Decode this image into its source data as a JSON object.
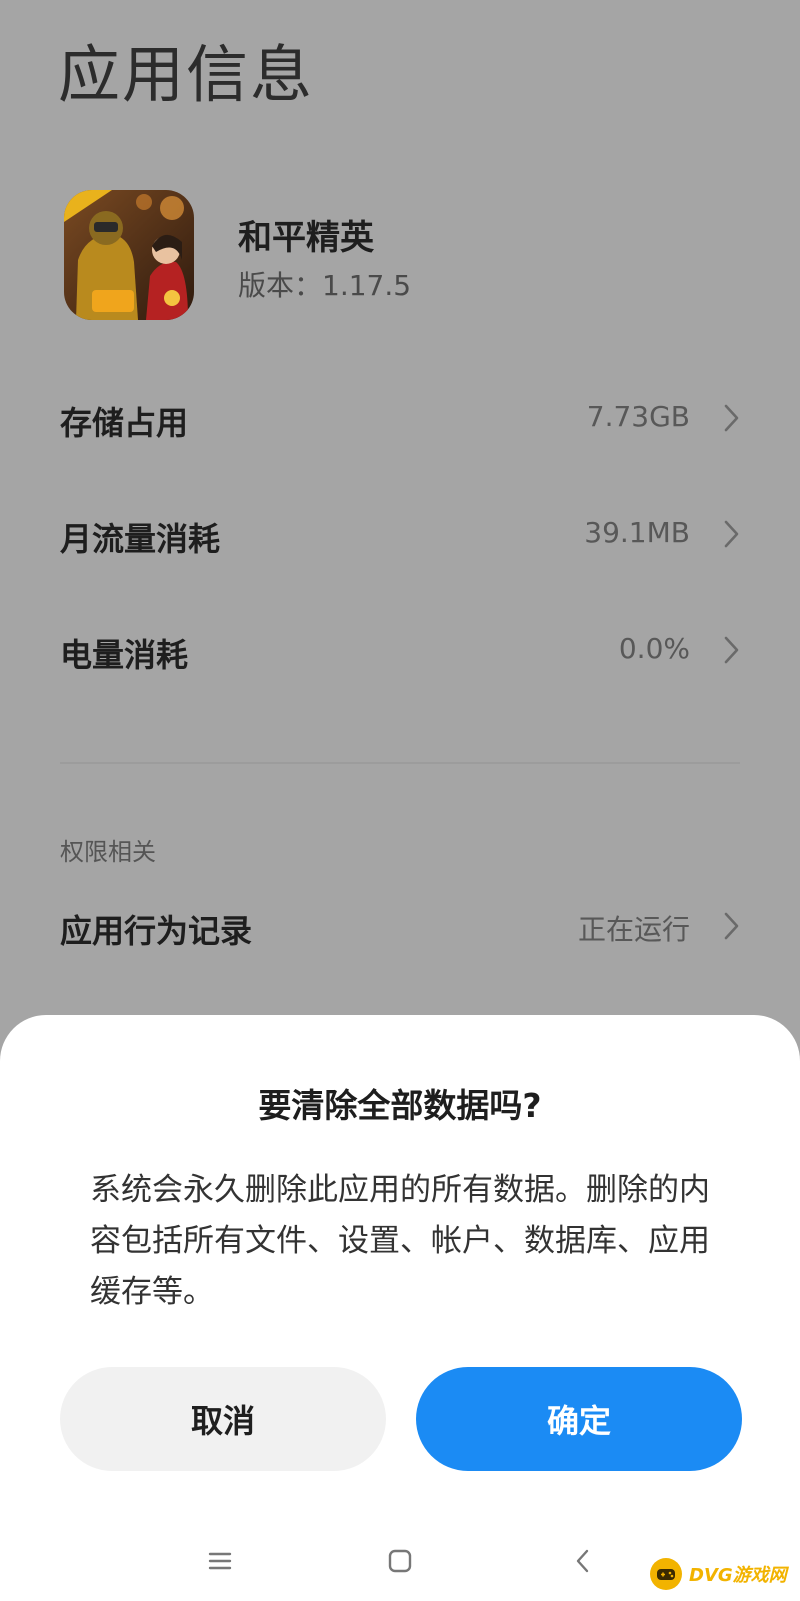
{
  "page": {
    "title": "应用信息"
  },
  "app": {
    "name": "和平精英",
    "version": "版本：1.17.5"
  },
  "rows": [
    {
      "label": "存储占用",
      "value": "7.73GB"
    },
    {
      "label": "月流量消耗",
      "value": "39.1MB"
    },
    {
      "label": "电量消耗",
      "value": "0.0%"
    }
  ],
  "permissions": {
    "section_label": "权限相关",
    "row": {
      "label": "应用行为记录",
      "value": "正在运行"
    }
  },
  "dialog": {
    "title": "要清除全部数据吗?",
    "message": "系统会永久删除此应用的所有数据。删除的内容包括所有文件、设置、帐户、数据库、应用缓存等。",
    "cancel_label": "取消",
    "confirm_label": "确定"
  },
  "navbar": {
    "icons": [
      "menu-icon",
      "home-icon",
      "back-icon"
    ]
  },
  "watermark": {
    "text": "DVG游戏网"
  },
  "colors": {
    "background": "#a5a5a5",
    "sheet": "#ffffff",
    "confirm_button": "#1b8bf4",
    "cancel_button": "#f1f1f1",
    "watermark": "#f2b300"
  }
}
